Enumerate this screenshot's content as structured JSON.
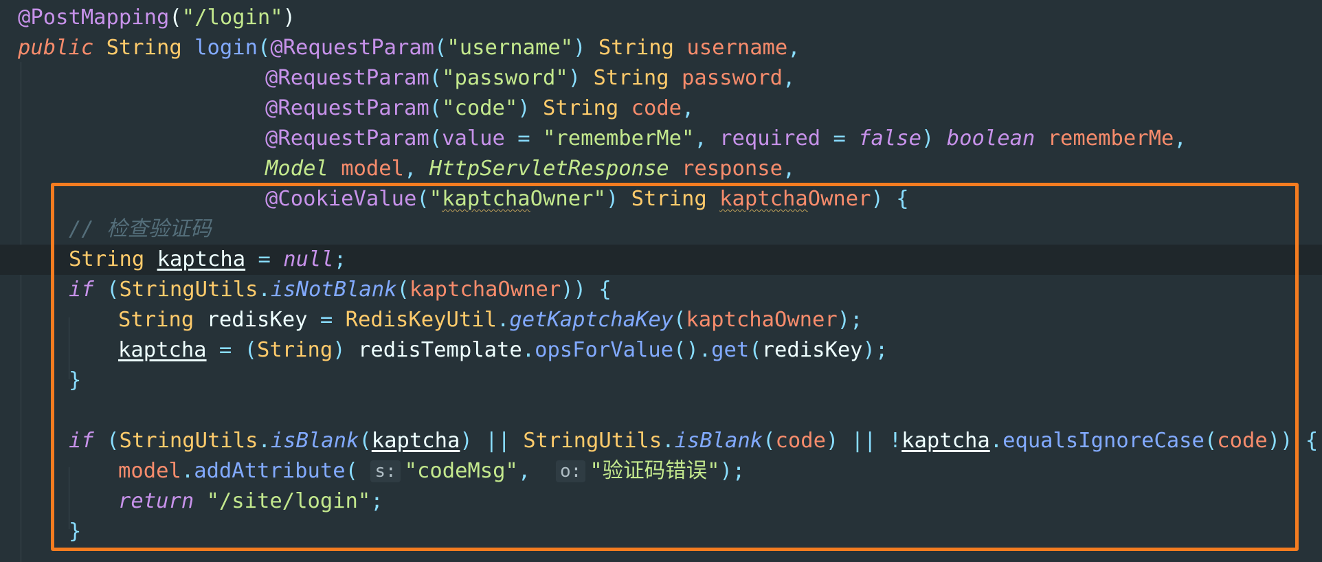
{
  "editor": {
    "lines": {
      "l1": {
        "ann": "@PostMapping",
        "p1": "(",
        "s1": "\"/login\"",
        "p2": ")"
      },
      "l2": {
        "kw": "public",
        "type": "String",
        "fn": "login",
        "p1": "(",
        "ann": "@RequestParam",
        "p2": "(",
        "s1": "\"username\"",
        "p3": ")",
        "type2": "String",
        "param": "username",
        "comma": ","
      },
      "l3": {
        "ann": "@RequestParam",
        "p1": "(",
        "s1": "\"password\"",
        "p2": ")",
        "type": "String",
        "param": "password",
        "comma": ","
      },
      "l4": {
        "ann": "@RequestParam",
        "p1": "(",
        "s1": "\"code\"",
        "p2": ")",
        "type": "String",
        "param": "code",
        "comma": ","
      },
      "l5": {
        "ann": "@RequestParam",
        "p1": "(",
        "attr1": "value",
        "eq1": "=",
        "s1": "\"rememberMe\"",
        "c1": ",",
        "attr2": "required",
        "eq2": "=",
        "kw": "false",
        "p2": ")",
        "type": "boolean",
        "param": "rememberMe",
        "comma": ","
      },
      "l6": {
        "type1": "Model",
        "param1": "model",
        "c1": ",",
        "type2": "HttpServletResponse",
        "param2": "response",
        "comma": ","
      },
      "l7": {
        "ann": "@CookieValue",
        "p1": "(",
        "s1a": "\"",
        "s1b": "kaptcha",
        "s1c": "Owner\"",
        "p2": ")",
        "type": "String",
        "param_a": "kaptcha",
        "param_b": "Owner",
        "p3": ")",
        "brace": "{"
      },
      "l8": {
        "comment": "// 检查验证码"
      },
      "l9": {
        "type": "String",
        "var": "kaptcha",
        "eq": "=",
        "kw": "null",
        "semi": ";"
      },
      "l10": {
        "kw": "if",
        "p1": "(",
        "cls": "StringUtils",
        "dot": ".",
        "fn": "isNotBlank",
        "p2": "(",
        "arg": "kaptchaOwner",
        "p3": "))",
        "brace": "{"
      },
      "l11": {
        "type": "String",
        "var": "redisKey",
        "eq": "=",
        "cls": "RedisKeyUtil",
        "dot": ".",
        "fn": "getKaptchaKey",
        "p1": "(",
        "arg": "kaptchaOwner",
        "p2": ");"
      },
      "l12": {
        "var": "kaptcha",
        "eq": "=",
        "p1": "(",
        "cast": "String",
        "p2": ")",
        "obj": "redisTemplate",
        "dot1": ".",
        "fn1": "opsForValue",
        "p3": "().",
        "fn2": "get",
        "p4": "(",
        "arg": "redisKey",
        "p5": ");"
      },
      "l13": {
        "brace": "}"
      },
      "l15": {
        "kw": "if",
        "p1": "(",
        "cls1": "StringUtils",
        "dot1": ".",
        "fn1": "isBlank",
        "p2": "(",
        "arg1": "kaptcha",
        "p3": ")",
        "or1": "||",
        "cls2": "StringUtils",
        "dot2": ".",
        "fn2": "isBlank",
        "p4": "(",
        "arg2": "code",
        "p5": ")",
        "or2": "||",
        "not": "!",
        "var": "kaptcha",
        "dot3": ".",
        "fn3": "equalsIgnoreCase",
        "p6": "(",
        "arg3": "code",
        "p7": "))",
        "brace": "{"
      },
      "l16": {
        "obj": "model",
        "dot": ".",
        "fn": "addAttribute",
        "p1": "(",
        "hint1": "s:",
        "s1": "\"codeMsg\"",
        "c1": ",",
        "hint2": "o:",
        "s2": "\"验证码错误\"",
        "p2": ");"
      },
      "l17": {
        "kw": "return",
        "s1": "\"/site/login\"",
        "semi": ";"
      },
      "l18": {
        "brace": "}"
      }
    }
  },
  "colors": {
    "background": "#263238",
    "highlight_box": "#f47c20",
    "annotation": "#c792ea",
    "string": "#c3e88d",
    "type": "#ffcb6b",
    "function": "#82aaff",
    "parameter": "#f78c6c",
    "comment": "#546e7a"
  }
}
